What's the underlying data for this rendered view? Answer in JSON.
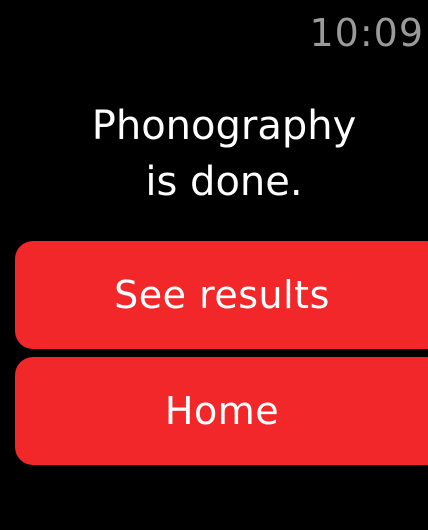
{
  "status_bar": {
    "time": "10:09"
  },
  "message": {
    "line1": "Phonography",
    "line2": "is done."
  },
  "buttons": {
    "see_results_label": "See results",
    "home_label": "Home"
  },
  "colors": {
    "background": "#000000",
    "button": "#f2272a",
    "time_text": "#9a9a9a",
    "text": "#ffffff"
  }
}
